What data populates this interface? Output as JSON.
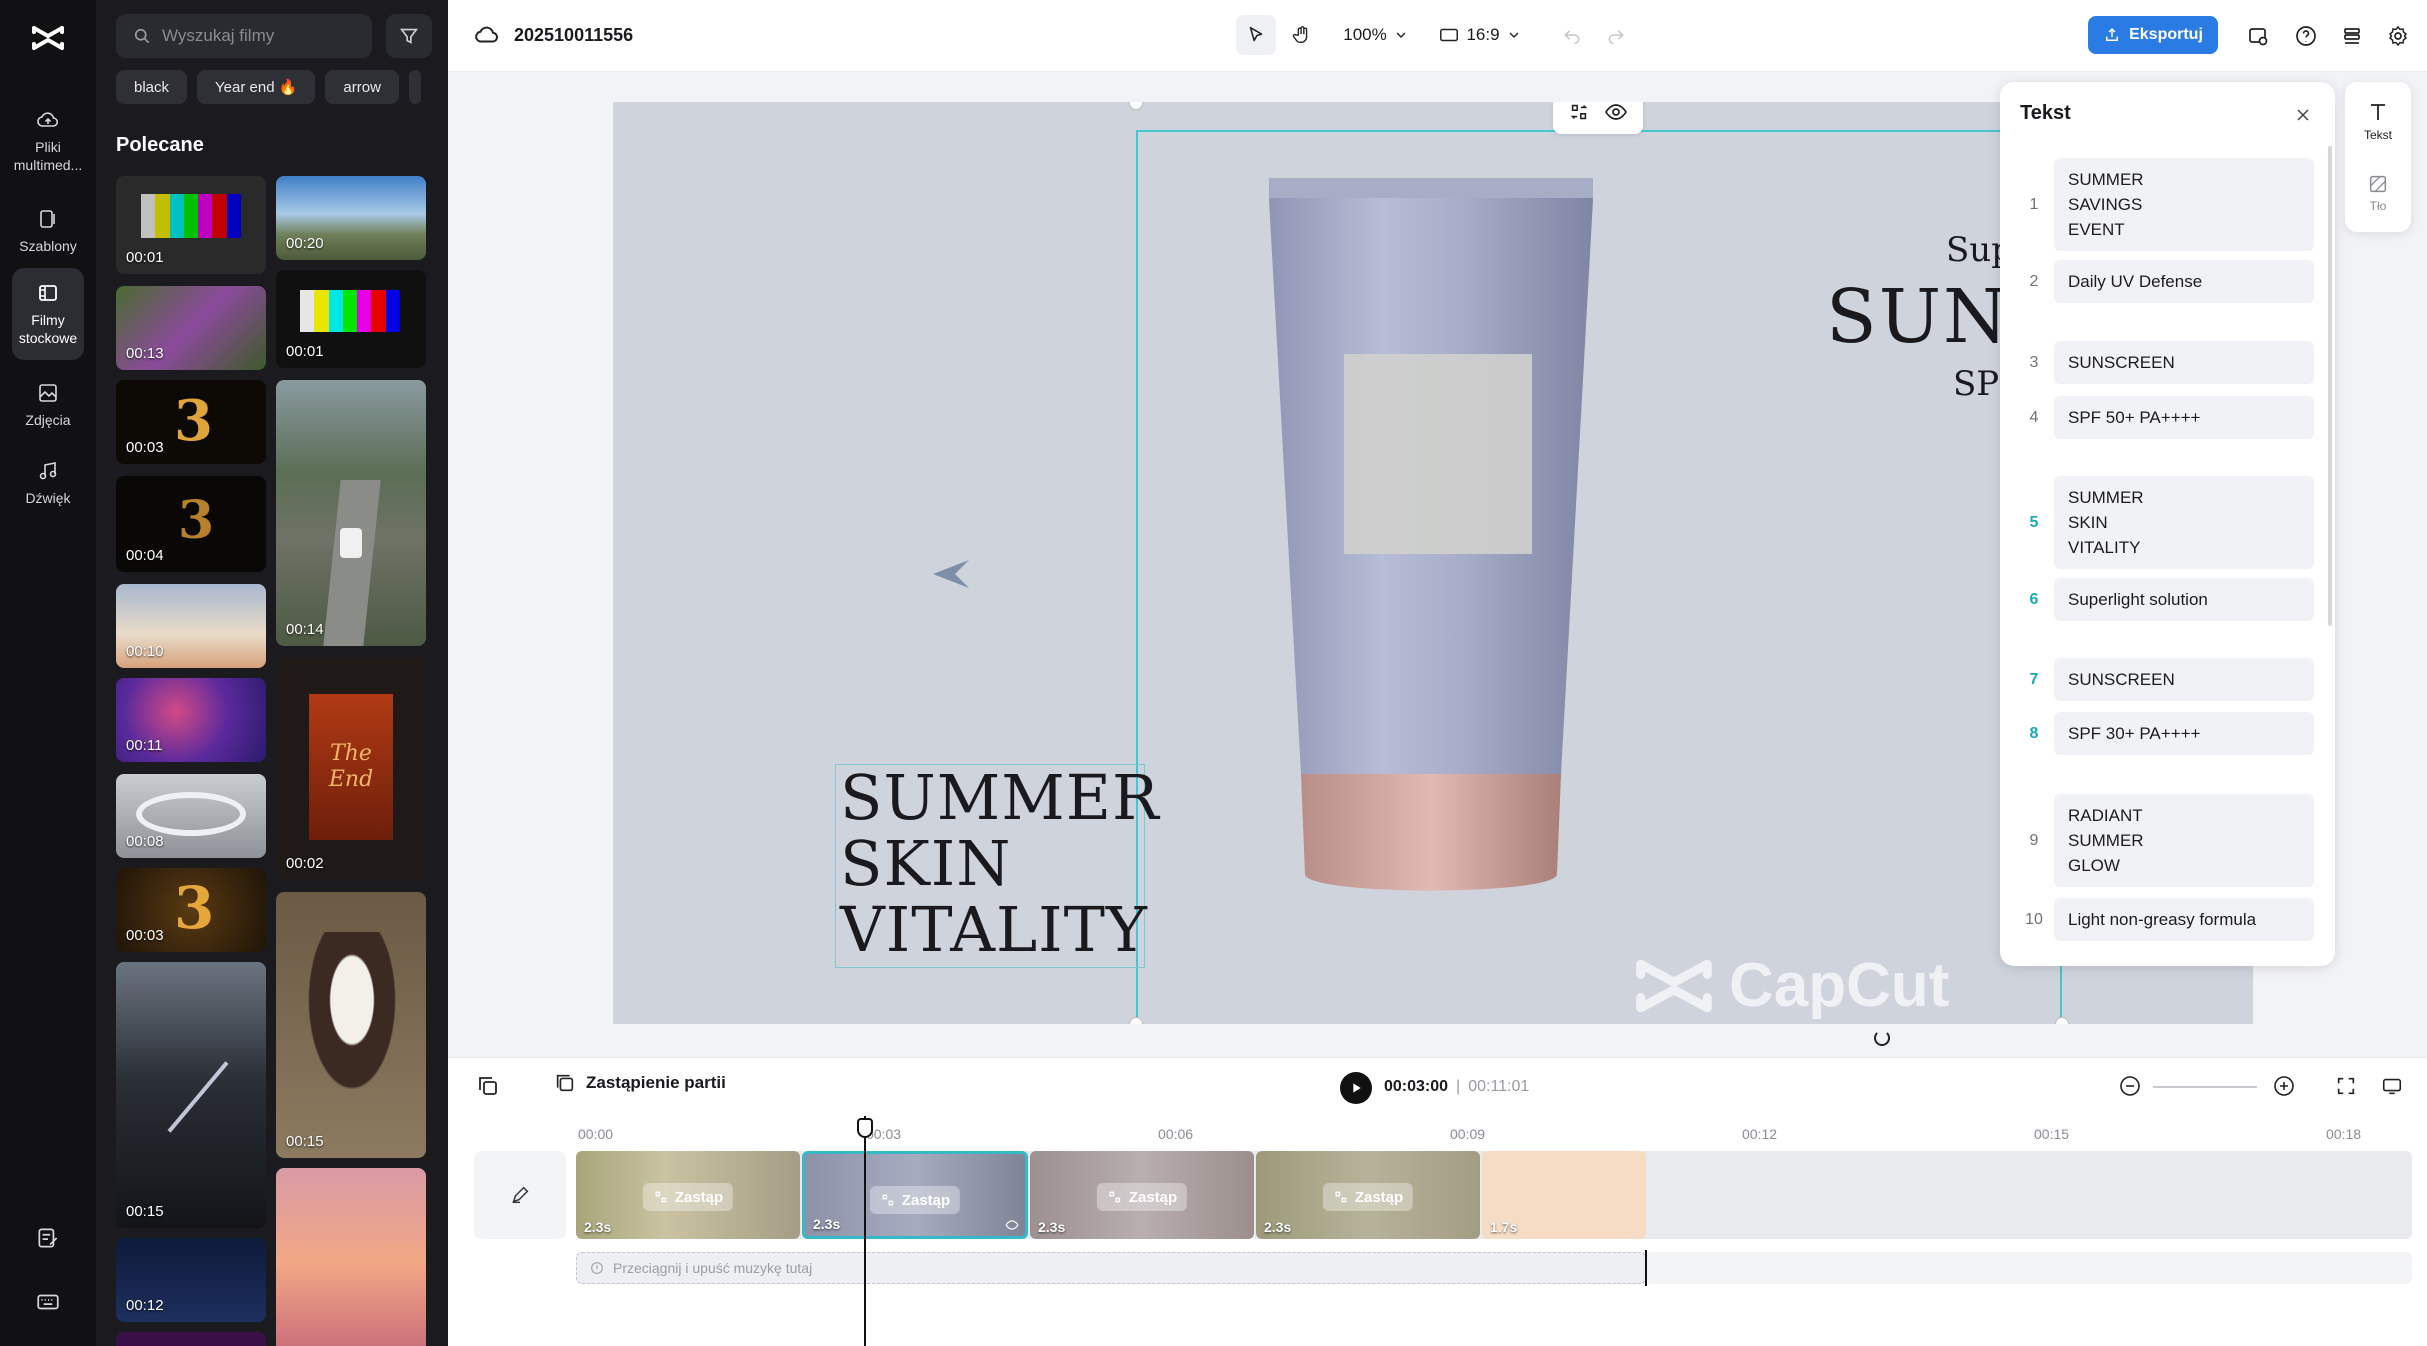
{
  "rail": {
    "items": [
      {
        "label": "Pliki\nmultimed..."
      },
      {
        "label": "Szablony"
      },
      {
        "label": "Filmy\nstockowe"
      },
      {
        "label": "Zdjęcia"
      },
      {
        "label": "Dźwięk"
      }
    ]
  },
  "media": {
    "search_placeholder": "Wyszukaj filmy",
    "chips": [
      "black",
      "Year end 🔥",
      "arrow"
    ],
    "section_title": "Polecane",
    "left_column": [
      {
        "duration": "00:01"
      },
      {
        "duration": "00:13"
      },
      {
        "duration": "00:03"
      },
      {
        "duration": "00:04"
      },
      {
        "duration": "00:10"
      },
      {
        "duration": "00:11"
      },
      {
        "duration": "00:08"
      },
      {
        "duration": "00:03"
      },
      {
        "duration": "00:15"
      },
      {
        "duration": "00:12"
      }
    ],
    "right_column": [
      {
        "duration": "00:20"
      },
      {
        "duration": "00:01"
      },
      {
        "duration": "00:14"
      },
      {
        "duration": "00:02"
      },
      {
        "duration": "00:15"
      },
      {
        "duration": ""
      }
    ],
    "the_end_text": "The End"
  },
  "topbar": {
    "project_name": "202510011556",
    "zoom": "100%",
    "aspect": "16:9",
    "export_label": "Eksportuj"
  },
  "canvas": {
    "main_text": "SUMMER\nSKIN\nVITALITY",
    "right_small": "Sup",
    "right_big": "SUNS",
    "right_spf": "SPF",
    "watermark": "CapCut"
  },
  "text_panel": {
    "title": "Tekst",
    "items": [
      {
        "num": "1",
        "text": "SUMMER\nSAVINGS\nEVENT",
        "highlight": false
      },
      {
        "num": "2",
        "text": "Daily UV Defense\n ",
        "highlight": false
      },
      {
        "num": "3",
        "text": "SUNSCREEN",
        "highlight": false
      },
      {
        "num": "4",
        "text": "SPF 50+    PA++++\n ",
        "highlight": false
      },
      {
        "num": "5",
        "text": "SUMMER\nSKIN\nVITALITY",
        "highlight": true
      },
      {
        "num": "6",
        "text": "Superlight solution\n ",
        "highlight": true
      },
      {
        "num": "7",
        "text": "SUNSCREEN",
        "highlight": true
      },
      {
        "num": "8",
        "text": "SPF 30+    PA++++\n ",
        "highlight": true
      },
      {
        "num": "9",
        "text": "RADIANT\nSUMMER\nGLOW",
        "highlight": false
      },
      {
        "num": "10",
        "text": "Light non-greasy formula",
        "highlight": false
      }
    ]
  },
  "side_tabs": [
    {
      "label": "Tekst"
    },
    {
      "label": "Tło"
    }
  ],
  "timeline": {
    "replace_part_label": "Zastąpienie partii",
    "current_time": "00:03:00",
    "separator": "|",
    "total_time": "00:11:01",
    "ruler_labels": [
      "00:00",
      "00:03",
      "00:06",
      "00:09",
      "00:12",
      "00:15",
      "00:18"
    ],
    "clips": [
      {
        "duration": "2.3s",
        "replace_label": "Zastąp"
      },
      {
        "duration": "2.3s",
        "replace_label": "Zastąp"
      },
      {
        "duration": "2.3s",
        "replace_label": "Zastąp"
      },
      {
        "duration": "2.3s",
        "replace_label": "Zastąp"
      },
      {
        "duration": "1.7s",
        "replace_label": ""
      }
    ],
    "music_placeholder": "Przeciągnij i upuść muzykę tutaj"
  },
  "colors": {
    "accent": "#2b7be4",
    "selection": "#46c4d0",
    "rail_bg": "#111113",
    "panel_bg": "#1b1b1f"
  }
}
